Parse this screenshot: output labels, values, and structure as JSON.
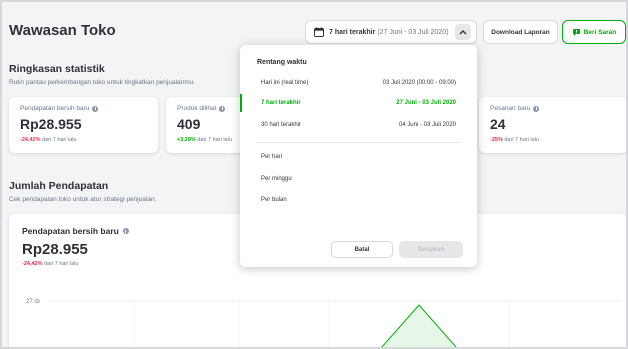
{
  "header": {
    "title": "Wawasan Toko",
    "date_button": {
      "label": "7 hari terakhir",
      "range": "(27 Juni - 03 Juli 2020)"
    },
    "download_label": "Download Laporan",
    "saran_label": "Beri Saran"
  },
  "summary": {
    "title": "Ringkasan statistik",
    "subtitle": "Rutin pantau perkembangan toko untuk tingkatkan penjualanmu.",
    "cards": [
      {
        "label": "Pendapatan bersih baru",
        "value": "Rp28.955",
        "change": "-24,42%",
        "change_suffix": "dari 7 hari lalu",
        "color": "#e02954"
      },
      {
        "label": "Produk dilihat",
        "value": "409",
        "change": "+3,28%",
        "change_suffix": "dari 7 hari lalu",
        "color": "#03ac0e"
      },
      {
        "label": "Pesanan baru",
        "value": "24",
        "change": "-25%",
        "change_suffix": "dari 7 hari lalu",
        "color": "#e02954"
      }
    ]
  },
  "income": {
    "title": "Jumlah Pendapatan",
    "subtitle": "Cek pendapatan toko untuk atur strategi penjualan.",
    "card": {
      "label": "Pendapatan bersih baru",
      "value": "Rp28.955",
      "change": "-24,42%",
      "change_suffix": "dari 7 hari lalu"
    },
    "y_tick": "27 rb"
  },
  "dropdown": {
    "title": "Rentang waktu",
    "options": [
      {
        "label": "Hari ini (real time)",
        "range": "03 Juli 2020 (00:00 - 09:00)",
        "active": false
      },
      {
        "label": "7 hari terakhir",
        "range": "27 Juni - 03 Juli 2020",
        "active": true
      },
      {
        "label": "30 hari terakhir",
        "range": "04 Juni - 03 Juli 2020",
        "active": false
      }
    ],
    "periods": [
      "Per hari",
      "Per minggu",
      "Per bulan"
    ],
    "cancel_label": "Batal",
    "apply_label": "Terapkan"
  },
  "colors": {
    "accent": "#03ac0e",
    "negative": "#e02954",
    "text": "#31353b"
  }
}
